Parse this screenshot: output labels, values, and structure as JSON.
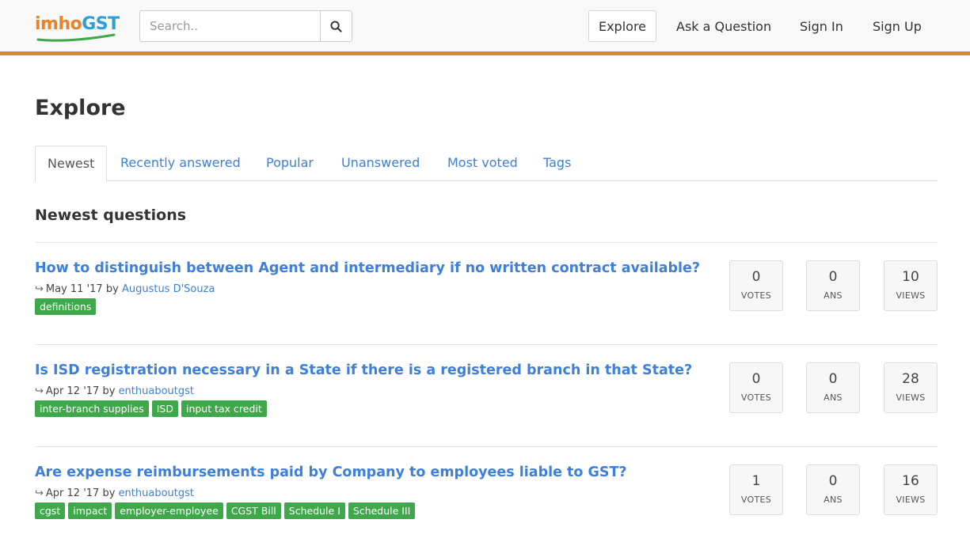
{
  "brand": {
    "logo_imho": "imho",
    "logo_gst": "GST",
    "orange": "#e8822b",
    "blue": "#2b9fd6",
    "link_color": "#3e7fd9",
    "tag_color": "#3ea84a"
  },
  "header": {
    "search": {
      "placeholder": "Search.."
    },
    "nav": {
      "explore": "Explore",
      "ask": "Ask a Question",
      "signin": "Sign In",
      "signup": "Sign Up"
    }
  },
  "main": {
    "title": "Explore",
    "tabs": [
      "Newest",
      "Recently answered",
      "Popular",
      "Unanswered",
      "Most voted",
      "Tags"
    ],
    "section_title": "Newest questions",
    "questions": [
      {
        "title": "How to distinguish between Agent and intermediary if no written contract available?",
        "date": "May 11 '17",
        "by": "by",
        "author": "Augustus D'Souza",
        "tags": [
          "definitions"
        ],
        "votes": "0",
        "votes_label": "VOTES",
        "answers": "0",
        "answers_label": "ANS",
        "views": "10",
        "views_label": "VIEWS"
      },
      {
        "title": "Is ISD registration necessary in a State if there is a registered branch in that State?",
        "date": "Apr 12 '17",
        "by": "by",
        "author": "enthuaboutgst",
        "tags": [
          "inter-branch supplies",
          "ISD",
          "input tax credit"
        ],
        "votes": "0",
        "votes_label": "VOTES",
        "answers": "0",
        "answers_label": "ANS",
        "views": "28",
        "views_label": "VIEWS"
      },
      {
        "title": "Are expense reimbursements paid by Company to employees liable to GST?",
        "date": "Apr 12 '17",
        "by": "by",
        "author": "enthuaboutgst",
        "tags": [
          "cgst",
          "impact",
          "employer-employee",
          "CGST Bill",
          "Schedule I",
          "Schedule III"
        ],
        "votes": "1",
        "votes_label": "VOTES",
        "answers": "0",
        "answers_label": "ANS",
        "views": "16",
        "views_label": "VIEWS"
      }
    ]
  }
}
